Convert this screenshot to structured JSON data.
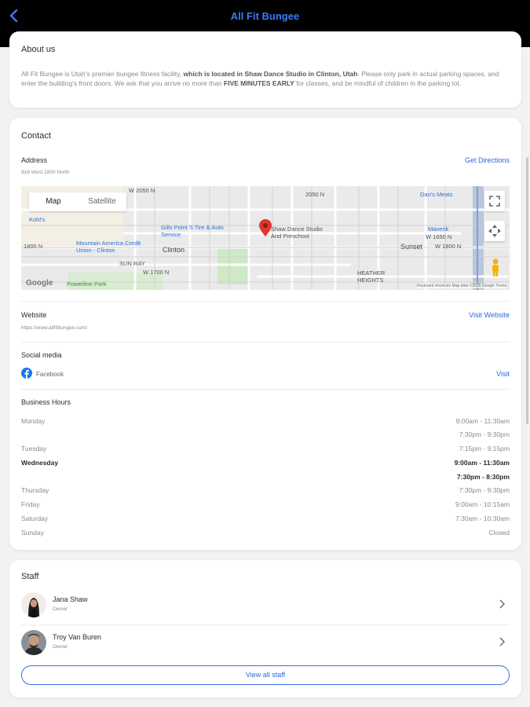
{
  "header": {
    "title": "All Fit Bungee"
  },
  "about": {
    "heading": "About us",
    "text_1": "All Fit Bungee is Utah's premier bungee fitness facility, ",
    "text_2": "which is located in Shaw Dance Studio in Clinton, Utah",
    "text_3": ". Please only park in actual parking spaces, and enter the building's front doors. We ask that you arrive no more than ",
    "text_4": "FIVE MINUTES EARLY",
    "text_5": " for classes, and be mindful of children in the parking lot."
  },
  "contact": {
    "heading": "Contact",
    "address_label": "Address",
    "address_value": "916 West 1800 North",
    "directions_link": "Get Directions",
    "map": {
      "toggle_map": "Map",
      "toggle_satellite": "Satellite",
      "pin_label": "Shaw Dance Studio And Preschool",
      "labels": [
        "Kohl's",
        "Gills Point S Tire & Auto Service",
        "Mountain America Credit Union - Clinton",
        "Clinton",
        "SUN RAY",
        "Powerline Park",
        "Sunset",
        "HEATHER HEIGHTS",
        "Dan's Meats",
        "Maverik",
        "W 1800 N",
        "W 2050 N",
        "2050 N",
        "W 1700 N",
        "1800 N",
        "W 1650 N"
      ],
      "google": "Google",
      "footer": "Keyboard shortcuts   Map data ©2025 Google   Terms"
    },
    "website_label": "Website",
    "website_value": "https://www.allfitbungee.com/",
    "website_link": "Visit Website",
    "social_label": "Social media",
    "social_name": "Facebook",
    "social_link": "Visit",
    "hours_label": "Business Hours",
    "hours": [
      {
        "day": "Monday",
        "time": "9:00am - 11:30am"
      },
      {
        "day": "",
        "time": "7:30pm - 9:30pm"
      },
      {
        "day": "Tuesday",
        "time": "7:15pm - 9:15pm"
      },
      {
        "day": "Wednesday",
        "time": "9:00am - 11:30am"
      },
      {
        "day": "",
        "time": "7:30pm - 8:30pm"
      },
      {
        "day": "Thursday",
        "time": "7:30pm - 9:30pm"
      },
      {
        "day": "Friday",
        "time": "9:00am - 10:15am"
      },
      {
        "day": "Saturday",
        "time": "7:30am - 10:30am"
      },
      {
        "day": "Sunday",
        "time": "Closed"
      }
    ]
  },
  "staff": {
    "heading": "Staff",
    "members": [
      {
        "name": "Jana Shaw",
        "role": "Owner"
      },
      {
        "name": "Troy Van Buren",
        "role": "Owner"
      }
    ],
    "view_all": "View all staff"
  },
  "colors": {
    "accent": "#2f66e0",
    "title": "#3d7bf2",
    "topbar": "#000000"
  },
  "icons": [
    "chevron-left-icon",
    "facebook-icon",
    "chevron-right-icon",
    "map-pin-icon",
    "fullscreen-icon",
    "pegman-icon"
  ]
}
